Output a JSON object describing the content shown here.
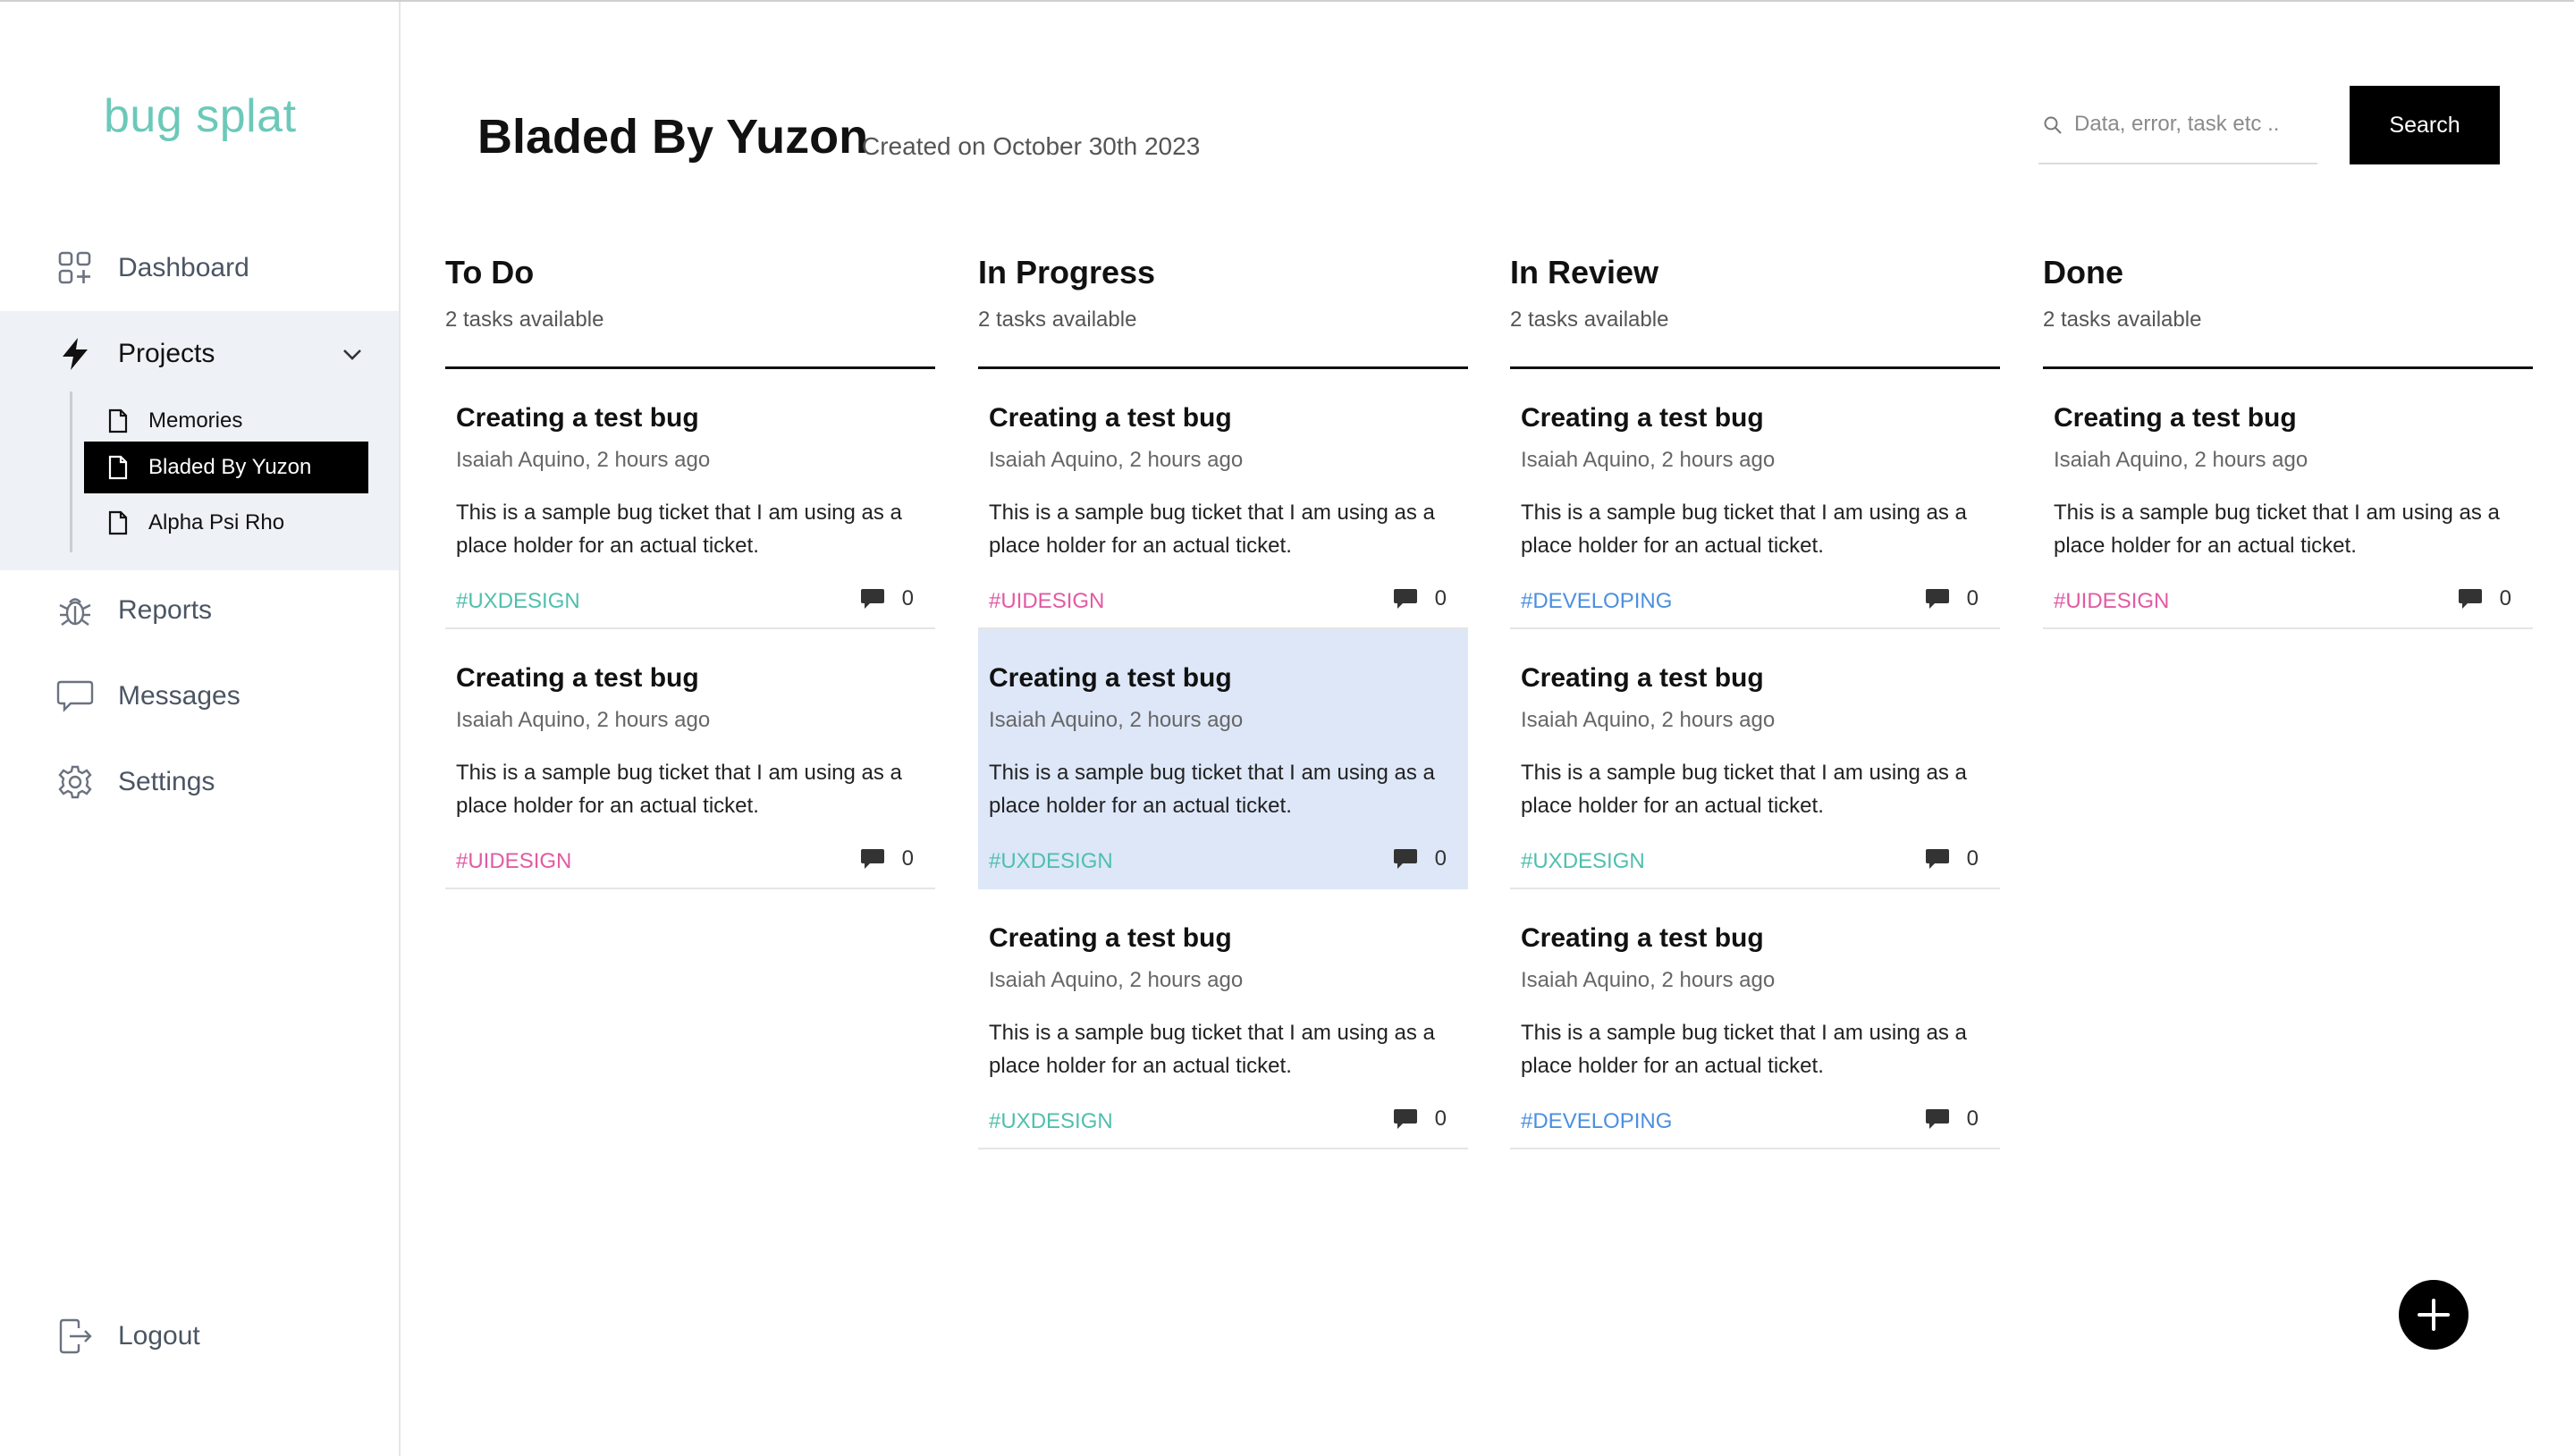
{
  "app": {
    "logo": "bug splat"
  },
  "sidebar": {
    "nav": [
      {
        "label": "Dashboard",
        "icon": "dashboard-icon"
      },
      {
        "label": "Projects",
        "icon": "lightning-icon"
      },
      {
        "label": "Reports",
        "icon": "bug-icon"
      },
      {
        "label": "Messages",
        "icon": "chat-icon"
      },
      {
        "label": "Settings",
        "icon": "gear-icon"
      }
    ],
    "projects": [
      {
        "label": "Memories",
        "icon": "document-icon"
      },
      {
        "label": "Bladed By Yuzon",
        "icon": "document-icon",
        "active": true
      },
      {
        "label": "Alpha Psi Rho",
        "icon": "document-icon"
      }
    ],
    "logout": {
      "label": "Logout",
      "icon": "logout-icon"
    }
  },
  "header": {
    "title": "Bladed By Yuzon",
    "subtitle": "Created on October 30th 2023",
    "search": {
      "placeholder": "Data, error, task etc ..",
      "value": "",
      "button_label": "Search"
    }
  },
  "colors": {
    "accent": "#6cc9b9",
    "tag_uxdesign": "#4fbfae",
    "tag_uidesign": "#e25aa3",
    "tag_developing": "#4b8fe0",
    "highlight": "#dde7f8"
  },
  "columns": [
    {
      "title": "To Do",
      "count_label": "2 tasks available",
      "cards": [
        {
          "title": "Creating a test bug",
          "meta": "Isaiah Aquino, 2 hours ago",
          "description": "This is a sample bug ticket that I am using as a place holder for an actual ticket.",
          "tag": "#UXDESIGN",
          "tag_color": "#4fbfae",
          "comments": "0"
        },
        {
          "title": "Creating a test bug",
          "meta": "Isaiah Aquino, 2 hours ago",
          "description": "This is a sample bug ticket that I am using as a place holder for an actual ticket.",
          "tag": "#UIDESIGN",
          "tag_color": "#e25aa3",
          "comments": "0"
        }
      ]
    },
    {
      "title": "In Progress",
      "count_label": "2 tasks available",
      "cards": [
        {
          "title": "Creating a test bug",
          "meta": "Isaiah Aquino, 2 hours ago",
          "description": "This is a sample bug ticket that I am using as a place holder for an actual ticket.",
          "tag": "#UIDESIGN",
          "tag_color": "#e25aa3",
          "comments": "0"
        },
        {
          "title": "Creating a test bug",
          "meta": "Isaiah Aquino, 2 hours ago",
          "description": "This is a sample bug ticket that I am using as a place holder for an actual ticket.",
          "tag": "#UXDESIGN",
          "tag_color": "#4fbfae",
          "comments": "0",
          "highlighted": true
        },
        {
          "title": "Creating a test bug",
          "meta": "Isaiah Aquino, 2 hours ago",
          "description": "This is a sample bug ticket that I am using as a place holder for an actual ticket.",
          "tag": "#UXDESIGN",
          "tag_color": "#4fbfae",
          "comments": "0"
        }
      ]
    },
    {
      "title": "In Review",
      "count_label": "2 tasks available",
      "cards": [
        {
          "title": "Creating a test bug",
          "meta": "Isaiah Aquino, 2 hours ago",
          "description": "This is a sample bug ticket that I am using as a place holder for an actual ticket.",
          "tag": "#DEVELOPING",
          "tag_color": "#4b8fe0",
          "comments": "0"
        },
        {
          "title": "Creating a test bug",
          "meta": "Isaiah Aquino, 2 hours ago",
          "description": "This is a sample bug ticket that I am using as a place holder for an actual ticket.",
          "tag": "#UXDESIGN",
          "tag_color": "#4fbfae",
          "comments": "0"
        },
        {
          "title": "Creating a test bug",
          "meta": "Isaiah Aquino, 2 hours ago",
          "description": "This is a sample bug ticket that I am using as a place holder for an actual ticket.",
          "tag": "#DEVELOPING",
          "tag_color": "#4b8fe0",
          "comments": "0"
        }
      ]
    },
    {
      "title": "Done",
      "count_label": "2 tasks available",
      "cards": [
        {
          "title": "Creating a test bug",
          "meta": "Isaiah Aquino, 2 hours ago",
          "description": "This is a sample bug ticket that I am using as a place holder for an actual ticket.",
          "tag": "#UIDESIGN",
          "tag_color": "#e25aa3",
          "comments": "0"
        }
      ]
    }
  ],
  "fab": {
    "icon": "plus-icon"
  }
}
